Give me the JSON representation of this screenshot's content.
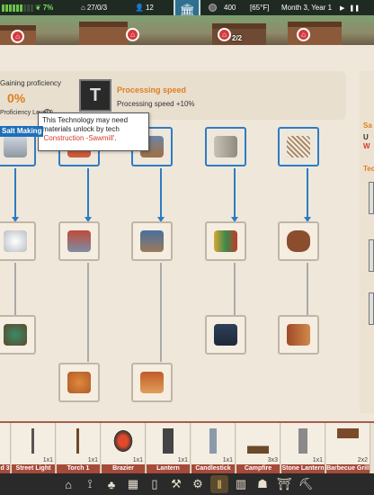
{
  "topbar": {
    "energy_pct": "7%",
    "date_code": "27/0/3",
    "population": "12",
    "coins": "400",
    "temperature": "[65°F]",
    "calendar": "Month 3, Year 1"
  },
  "village": {
    "quest_progress": "2/2"
  },
  "info": {
    "gaining_label": "Gaining proficiency",
    "gaining_value": "0%",
    "level_label": "Proficiency Level:0",
    "tech_title": "Processing speed",
    "tech_effect": "Processing speed +10%"
  },
  "tooltip": {
    "title": "Salt Making",
    "line1": "This Technology may need",
    "line2": "materials unlock by tech",
    "tech_name": "'Construction -Sawmill'",
    "period": "."
  },
  "right_panel": {
    "letters": [
      "Sa",
      "U",
      "W",
      "Tec"
    ]
  },
  "build_items": [
    {
      "name": "d 3",
      "size": "1x1"
    },
    {
      "name": "Street Light",
      "size": "1x1"
    },
    {
      "name": "Torch 1",
      "size": "1x1"
    },
    {
      "name": "Brazier",
      "size": "1x1"
    },
    {
      "name": "Lantern",
      "size": "1x1"
    },
    {
      "name": "Candlestick",
      "size": "1x1"
    },
    {
      "name": "Campfire",
      "size": "3x3"
    },
    {
      "name": "Stone Lantern",
      "size": "1x1"
    },
    {
      "name": "Barbecue Grill",
      "size": "2x2"
    }
  ],
  "colors": {
    "accent_orange": "#e07f1f",
    "active_blue": "#2e7cc2",
    "label_red": "#a64a3a"
  },
  "icons": [
    "home-icon",
    "carrot-icon",
    "tree-icon",
    "grid-icon",
    "door-icon",
    "axe-icon",
    "hammer-icon",
    "fence-icon",
    "building-icon",
    "tech-icon",
    "gate-icon",
    "pickaxe-icon"
  ]
}
